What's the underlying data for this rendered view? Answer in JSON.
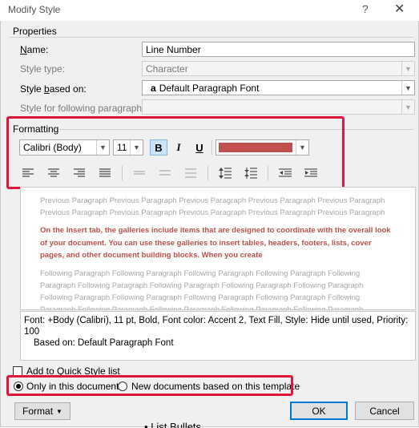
{
  "window": {
    "title": "Modify Style",
    "help": "?",
    "close": "✕"
  },
  "properties": {
    "group_label": "Properties",
    "name_label": "Name:",
    "name_value": "Line Number",
    "style_type_label": "Style type:",
    "style_type_value": "Character",
    "based_on_label": "Style based on:",
    "based_on_glyph": "a",
    "based_on_value": "Default Paragraph Font",
    "following_label": "Style for following paragraph:",
    "following_value": ""
  },
  "formatting": {
    "group_label": "Formatting",
    "font_value": "Calibri (Body)",
    "size_value": "11",
    "bold": "B",
    "italic": "I",
    "underline": "U",
    "font_color": "#c0504d"
  },
  "preview": {
    "previous_paragraph": "Previous Paragraph Previous Paragraph Previous Paragraph Previous Paragraph Previous Paragraph Previous Paragraph Previous Paragraph Previous Paragraph Previous Paragraph Previous Paragraph",
    "sample_text": "On the Insert tab, the galleries include items that are designed to coordinate with the overall look of your document. You can use these galleries to insert tables, headers, footers, lists, cover pages, and other document building blocks. When you create",
    "following_paragraph": "Following Paragraph Following Paragraph Following Paragraph Following Paragraph Following Paragraph Following Paragraph Following Paragraph Following Paragraph Following Paragraph Following Paragraph Following Paragraph Following Paragraph Following Paragraph Following Paragraph Following Paragraph Following Paragraph Following Paragraph Following Paragraph Following Paragraph Following Paragraph"
  },
  "description": {
    "line1": "Font: +Body (Calibri), 11 pt, Bold, Font color: Accent 2, Text Fill, Style: Hide until used, Priority: 100",
    "line2": "Based on: Default Paragraph Font"
  },
  "options": {
    "add_to_quick_style": "Add to Quick Style list",
    "only_this_document": "Only in this document",
    "new_documents": "New documents based on this template",
    "selected": "only_this_document"
  },
  "buttons": {
    "format": "Format",
    "ok": "OK",
    "cancel": "Cancel"
  },
  "background_fragment": "List Bullets"
}
